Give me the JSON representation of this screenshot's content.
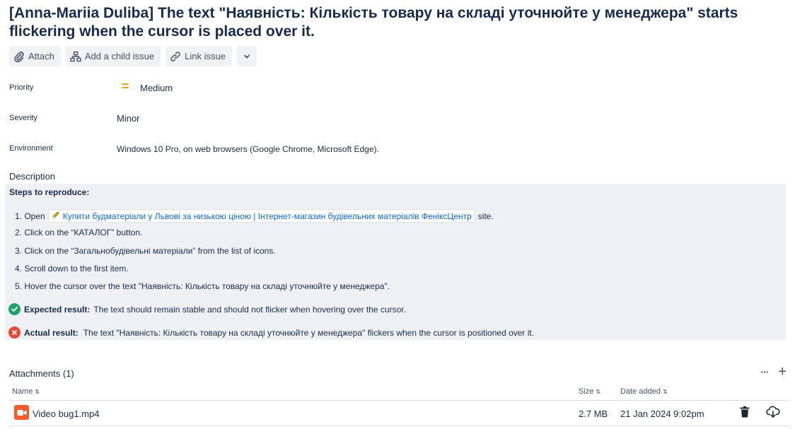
{
  "issue": {
    "title": "[Anna-Mariia Duliba] The text \"Наявність: Кількість товару на складі уточнюйте у менеджера\" starts flickering when the cursor is placed over it."
  },
  "toolbar": {
    "attach_label": "Attach",
    "child_issue_label": "Add a child issue",
    "link_issue_label": "Link issue"
  },
  "fields": {
    "priority": {
      "label": "Priority",
      "value": "Medium"
    },
    "severity": {
      "label": "Severity",
      "value": "Minor"
    },
    "environment": {
      "label": "Environment",
      "value": "Windows 10 Pro, on web browsers (Google Chrome, Microsoft Edge)."
    }
  },
  "description": {
    "label": "Description",
    "steps_title": "Steps to reproduce:",
    "step1_prefix": "1. Open",
    "step1_link": "Купити будматеріали у Львові за низькою ціною | Інтернет-магазин будівельних матеріалів ФеніксЦентр",
    "step1_suffix": "site.",
    "steps": [
      "2. Click on the “КАТАЛОГ” button.",
      "3. Click on the “Загальнобудівельні матеріали” from the list of icons.",
      "4. Scroll down to the first item.",
      "5. Hover the cursor over the text \"Наявність: Кількість товару на складі уточнюйте у менеджера\"."
    ],
    "expected_label": "Expected result:",
    "expected_text": "The text should remain stable and should not flicker when hovering over the cursor.",
    "actual_label": "Actual result:",
    "actual_text": "The text \"Наявність: Кількість товару на складі уточнюйте у менеджера\" flickers when the cursor is positioned over it."
  },
  "attachments": {
    "title": "Attachments (1)",
    "more_label": "···",
    "add_label": "+",
    "columns": {
      "name": "Name",
      "size": "Size",
      "date": "Date added"
    },
    "files": [
      {
        "name": "Video bug1.mp4",
        "size": "2.7 MB",
        "date": "21 Jan 2024 9:02pm"
      }
    ]
  },
  "colors": {
    "accent": "#0c66e4",
    "priority_medium": "#f8a000",
    "success": "#22a06b",
    "danger": "#e34935",
    "video_icon": "#f15b2a"
  }
}
